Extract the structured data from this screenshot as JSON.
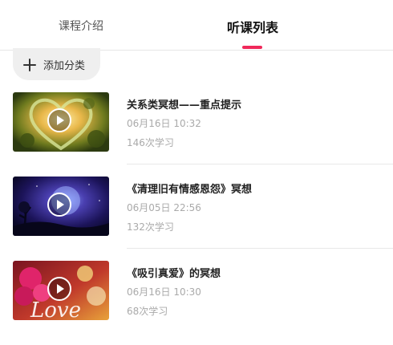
{
  "tabs": [
    {
      "label": "课程介绍",
      "active": false
    },
    {
      "label": "听课列表",
      "active": true
    }
  ],
  "accent_color": "#f0285a",
  "add_category": {
    "icon": "plus-icon",
    "label": "添加分类"
  },
  "lessons": [
    {
      "title": "关系类冥想——重点提示",
      "date": "06月16日 10:32",
      "count": "146次学习",
      "icon": "play-icon"
    },
    {
      "title": "《清理旧有情感恩怨》冥想",
      "date": "06月05日 22:56",
      "count": "132次学习",
      "icon": "play-icon"
    },
    {
      "title": "《吸引真爱》的冥想",
      "date": "06月16日 10:30",
      "count": "68次学习",
      "icon": "play-icon",
      "thumb_text": "Love"
    }
  ]
}
